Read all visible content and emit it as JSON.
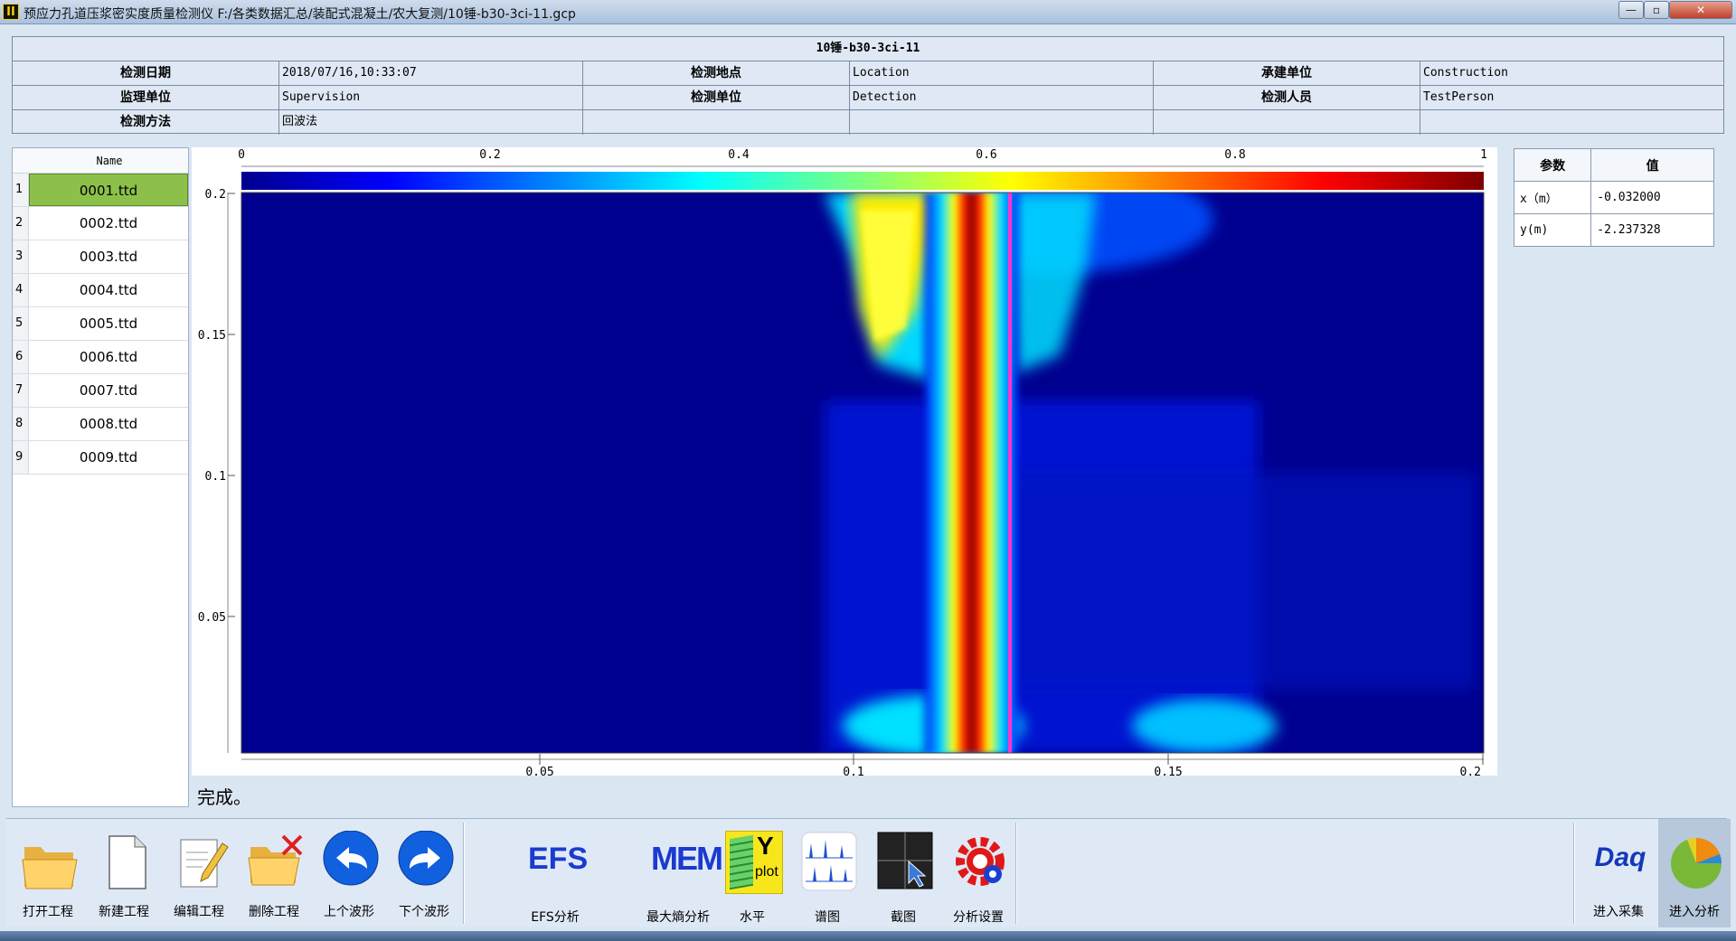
{
  "window": {
    "title": "预应力孔道压浆密实度质量检测仪   F:/各类数据汇总/装配式混凝土/农大复测/10锤-b30-3ci-11.gcp",
    "icon_letter": "II",
    "minimize": "—",
    "maximize": "▫",
    "close": "✕"
  },
  "info": {
    "title": "10锤-b30-3ci-11",
    "rows": [
      [
        "检测日期",
        "2018/07/16,10:33:07",
        "检测地点",
        "Location",
        "承建单位",
        "Construction"
      ],
      [
        "监理单位",
        "Supervision",
        "检测单位",
        "Detection",
        "检测人员",
        "TestPerson"
      ],
      [
        "检测方法",
        "回波法",
        "",
        "",
        "",
        ""
      ]
    ]
  },
  "filelist": {
    "header": "Name",
    "items": [
      {
        "n": "1",
        "name": "0001.ttd"
      },
      {
        "n": "2",
        "name": "0002.ttd"
      },
      {
        "n": "3",
        "name": "0003.ttd"
      },
      {
        "n": "4",
        "name": "0004.ttd"
      },
      {
        "n": "5",
        "name": "0005.ttd"
      },
      {
        "n": "6",
        "name": "0006.ttd"
      },
      {
        "n": "7",
        "name": "0007.ttd"
      },
      {
        "n": "8",
        "name": "0008.ttd"
      },
      {
        "n": "9",
        "name": "0009.ttd"
      }
    ],
    "selected": 0
  },
  "plot": {
    "colorbar_ticks": [
      "0",
      "0.2",
      "0.4",
      "0.6",
      "0.8",
      "1"
    ],
    "y_ticks": [
      "0.2",
      "0.15",
      "0.1",
      "0.05"
    ],
    "x_ticks": [
      "0.05",
      "0.1",
      "0.15",
      "0.2"
    ],
    "colors": {
      "low": "#00008f",
      "mid": "#00c8ff",
      "high": "#ffff00",
      "peak": "#7f0000",
      "marker": "#ff33cc"
    }
  },
  "status": "完成。",
  "params": {
    "headers": [
      "参数",
      "值"
    ],
    "rows": [
      [
        "x（m）",
        "-0.032000"
      ],
      [
        "y(m)",
        "-2.237328"
      ]
    ]
  },
  "toolbar": {
    "open": "打开工程",
    "new": "新建工程",
    "edit": "编辑工程",
    "delete": "删除工程",
    "prev": "上个波形",
    "next": "下个波形",
    "efs": "EFS分析",
    "efs_icon": "EFS",
    "mem": "最大熵分析",
    "mem_icon": "MEM",
    "level": "水平",
    "level_icon_y": "Y",
    "level_icon_plot": "plot",
    "spectrum": "谱图",
    "screenshot": "截图",
    "settings": "分析设置",
    "acquire": "进入采集",
    "acquire_icon": "Daq",
    "analyze": "进入分析"
  }
}
